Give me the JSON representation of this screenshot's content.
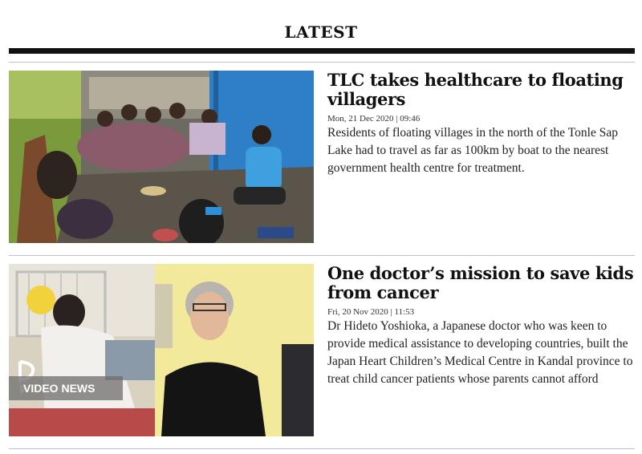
{
  "section": {
    "title": "LATEST"
  },
  "articles": [
    {
      "headline": "TLC takes healthcare to floating villagers",
      "date": "Mon, 21 Dec 2020 | 09:46",
      "summary": "Residents of floating villages in the north of the Tonle Sap Lake had to travel as far as 100km by boat to the nearest government health centre for treatment.",
      "image_desc": "group-of-villagers-seated-on-wooden-floor"
    },
    {
      "headline": "One doctor’s mission to save kids from cancer",
      "date": "Fri, 20 Nov 2020 | 11:53",
      "summary": "Dr Hideto Yoshioka, a Japanese doctor who was keen to provide medical assistance to developing countries, built the Japan Heart Children’s Medical Centre in Kandal province to treat child cancer patients whose parents cannot afford",
      "badge": "VIDEO NEWS"
    }
  ],
  "colors": {
    "rule": "#b9c2cc",
    "thick_rule": "#111111"
  }
}
